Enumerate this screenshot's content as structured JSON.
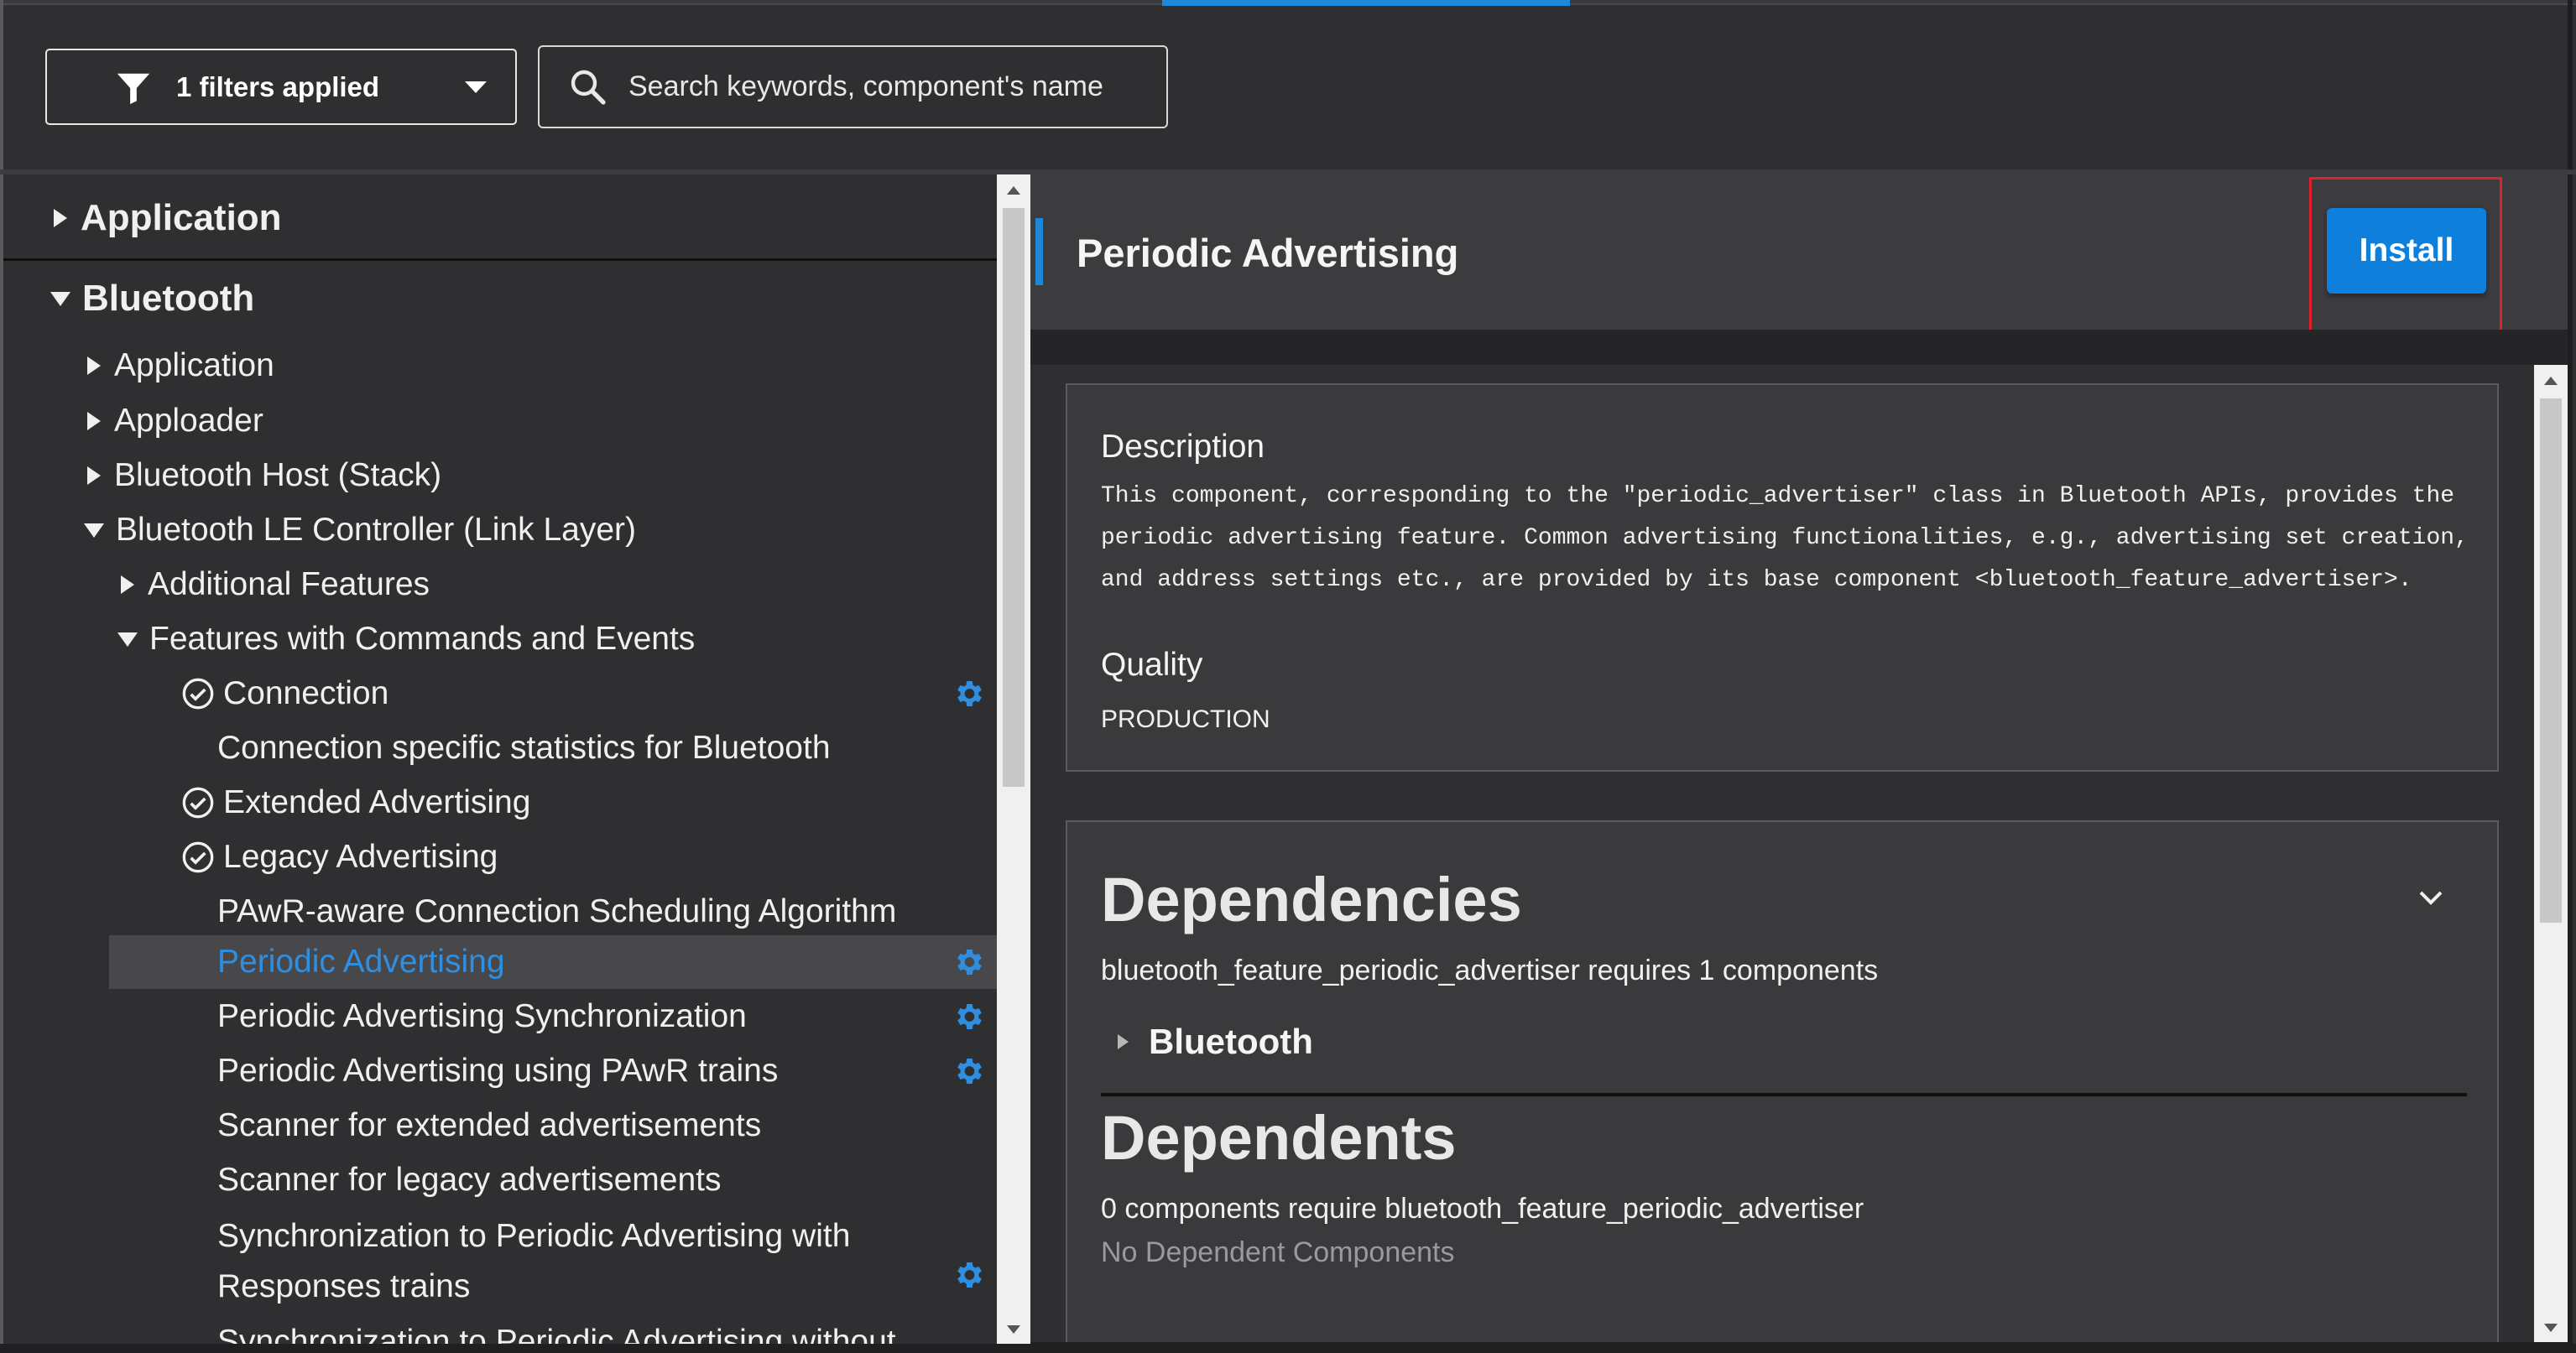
{
  "toolbar": {
    "filter_label": "1 filters applied",
    "search_placeholder": "Search keywords, component's name"
  },
  "tree": {
    "application": "Application",
    "bluetooth": "Bluetooth",
    "bt_application": "Application",
    "apploader": "Apploader",
    "bt_host": "Bluetooth Host (Stack)",
    "le_controller": "Bluetooth LE Controller (Link Layer)",
    "additional_features": "Additional Features",
    "features_cmds_events": "Features with Commands and Events",
    "items": [
      {
        "label": "Connection",
        "installed": true,
        "configurable": true
      },
      {
        "label": "Connection specific statistics for Bluetooth",
        "installed": false,
        "configurable": false
      },
      {
        "label": "Extended Advertising",
        "installed": true,
        "configurable": false
      },
      {
        "label": "Legacy Advertising",
        "installed": true,
        "configurable": false
      },
      {
        "label": "PAwR-aware Connection Scheduling Algorithm",
        "installed": false,
        "configurable": false
      },
      {
        "label": "Periodic Advertising",
        "installed": false,
        "configurable": true,
        "selected": true
      },
      {
        "label": "Periodic Advertising Synchronization",
        "installed": false,
        "configurable": true
      },
      {
        "label": "Periodic Advertising using PAwR trains",
        "installed": false,
        "configurable": true
      },
      {
        "label": "Scanner for extended advertisements",
        "installed": false,
        "configurable": false
      },
      {
        "label": "Scanner for legacy advertisements",
        "installed": false,
        "configurable": false
      },
      {
        "label": "Synchronization to Periodic Advertising with",
        "label_line2": "Responses trains",
        "installed": false,
        "configurable": true
      },
      {
        "label": "Synchronization to Periodic Advertising without",
        "installed": false,
        "configurable": false
      }
    ]
  },
  "detail": {
    "title": "Periodic Advertising",
    "install_label": "Install",
    "description_label": "Description",
    "description_lines": [
      "This component, corresponding to the \"periodic_advertiser\" class in Bluetooth APIs, provides the",
      "periodic advertising feature. Common advertising functionalities, e.g., advertising set creation,",
      "and address settings etc., are provided by its base component <bluetooth_feature_advertiser>."
    ],
    "quality_label": "Quality",
    "quality_value": "PRODUCTION",
    "dependencies_heading": "Dependencies",
    "dependencies_summary": "bluetooth_feature_periodic_advertiser requires 1 components",
    "dependency_item": "Bluetooth",
    "dependents_heading": "Dependents",
    "dependents_summary": "0 components require bluetooth_feature_periodic_advertiser",
    "dependents_empty": "No Dependent Components"
  },
  "colors": {
    "accent": "#1f87d8",
    "install": "#0f7fdc",
    "highlight": "#e0202a",
    "background": "#2f2f31"
  },
  "icons": [
    "filter-icon",
    "caret-down-icon",
    "search-icon",
    "check-circle-icon",
    "gear-icon",
    "chevron-down-icon"
  ]
}
